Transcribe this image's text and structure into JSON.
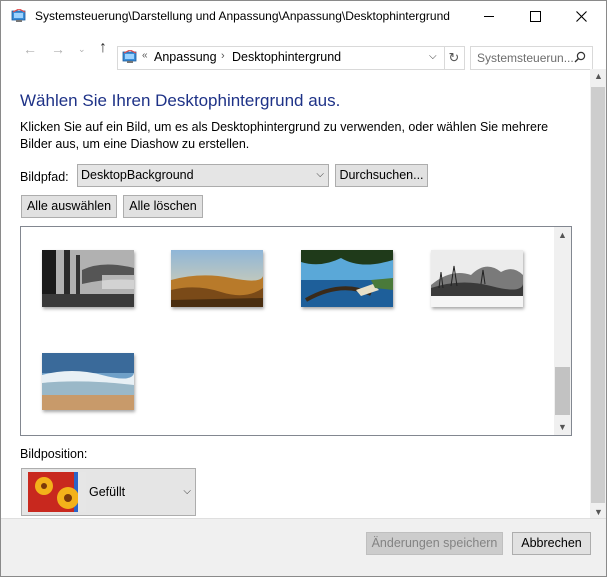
{
  "window": {
    "title": "Systemsteuerung\\Darstellung und Anpassung\\Anpassung\\Desktophintergrund"
  },
  "nav": {
    "breadcrumb_overflow": "«",
    "breadcrumbs": [
      "Anpassung",
      "Desktophintergrund"
    ],
    "search_placeholder": "Systemsteuerun..."
  },
  "content": {
    "heading": "Wählen Sie Ihren Desktophintergrund aus.",
    "description": "Klicken Sie auf ein Bild, um es als Desktophintergrund zu verwenden, oder wählen Sie mehrere Bilder aus, um eine Diashow zu erstellen.",
    "path_label": "Bildpfad:",
    "path_value": "DesktopBackground",
    "browse_label": "Durchsuchen...",
    "select_all_label": "Alle auswählen",
    "clear_all_label": "Alle löschen",
    "position_label": "Bildposition:",
    "position_value": "Gefüllt"
  },
  "footer": {
    "save_label": "Änderungen speichern",
    "cancel_label": "Abbrechen"
  },
  "colors": {
    "heading": "#1e3287",
    "window_border": "#8a8a8a",
    "footer_bg": "#f0f0f0"
  },
  "icons": [
    "control-panel-icon",
    "back-arrow-icon",
    "forward-arrow-icon",
    "recent-locations-icon",
    "up-arrow-icon",
    "refresh-icon",
    "search-icon",
    "chevron-down-icon"
  ]
}
